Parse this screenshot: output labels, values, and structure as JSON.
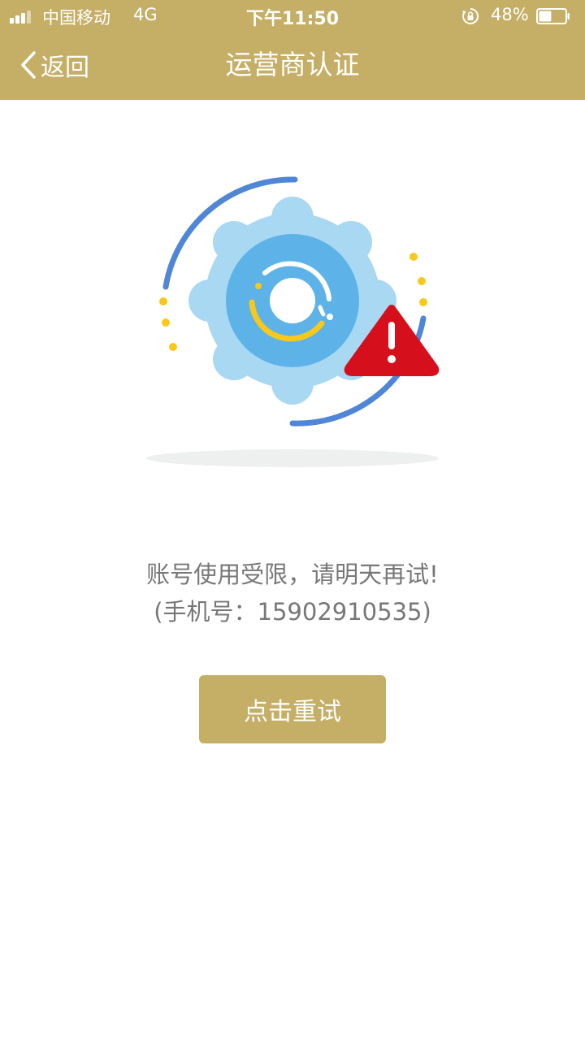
{
  "status_bar": {
    "carrier": "中国移动",
    "network": "4G",
    "time": "下午11:50",
    "battery_percent": "48%",
    "battery_level": 0.48,
    "orientation_lock_icon": "orientation-lock-icon",
    "signal_icon": "signal-bars-icon"
  },
  "nav": {
    "back_label": "返回",
    "back_icon": "chevron-left-icon",
    "title": "运营商认证"
  },
  "illustration": {
    "icon": "gear-with-warning-icon"
  },
  "message": {
    "line1": "账号使用受限，请明天再试!",
    "line2": "(手机号：15902910535)"
  },
  "actions": {
    "retry_label": "点击重试"
  },
  "colors": {
    "brand": "#c5ae66",
    "text_secondary": "#777777",
    "gear_light": "#a9d8f3",
    "gear_mid": "#5db3e8",
    "arc_blue": "#4f86d6",
    "accent_yellow": "#f8c81a",
    "warning_red": "#d50f1c"
  }
}
